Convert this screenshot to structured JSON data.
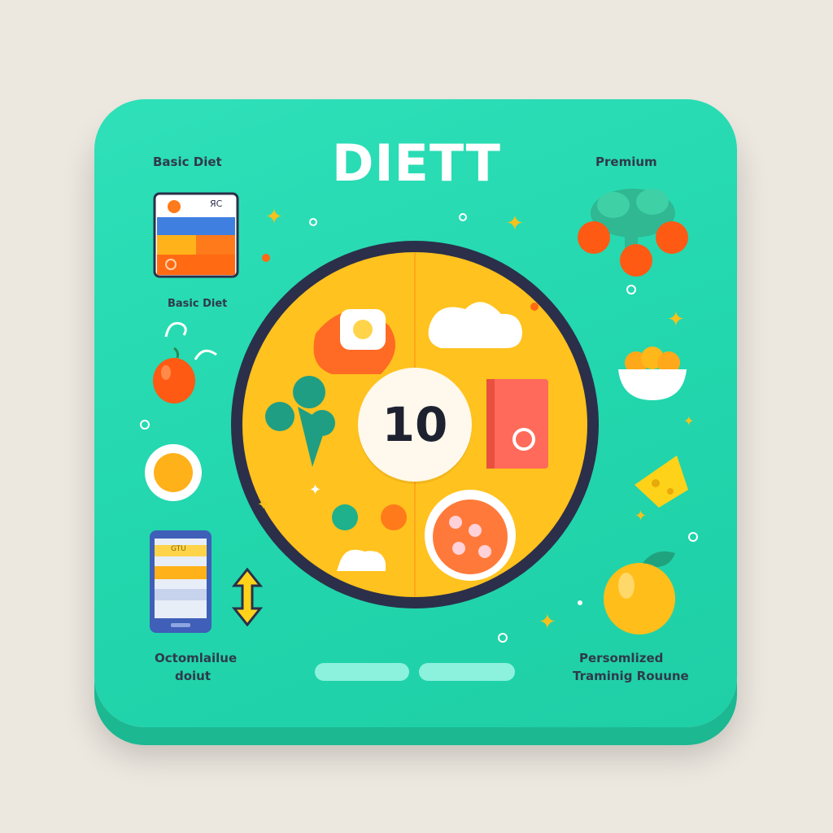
{
  "app": {
    "title": "DIETT",
    "center_value": "10",
    "labels": {
      "top_left": "Basic Diet",
      "left_middle": "Basic Diet",
      "top_right": "Premium",
      "bottom_left_line1": "Octomlailue",
      "bottom_left_line2": "doiut",
      "bottom_right_line1": "Persomlized",
      "bottom_right_line2": "Traminig Rouune"
    },
    "mini_card": {
      "corner_text": "ЯС"
    },
    "phone": {
      "screen_text": "GTU"
    },
    "colors": {
      "card": "#22d6ad",
      "ring": "#2b2f4a",
      "plate": "#ffc21e",
      "accent_orange": "#ff6a13"
    },
    "icons": [
      "chart-card-icon",
      "orange-fruit-icon",
      "egg-icon",
      "phone-icon",
      "arrow-up-down-icon",
      "shrimp-sushi-icon",
      "cloud-icon",
      "broccoli-icon",
      "red-book-icon",
      "berries-bowl-icon",
      "tree-fruit-icon",
      "fruit-bowl-icon",
      "cheese-icon",
      "orange-icon"
    ]
  }
}
